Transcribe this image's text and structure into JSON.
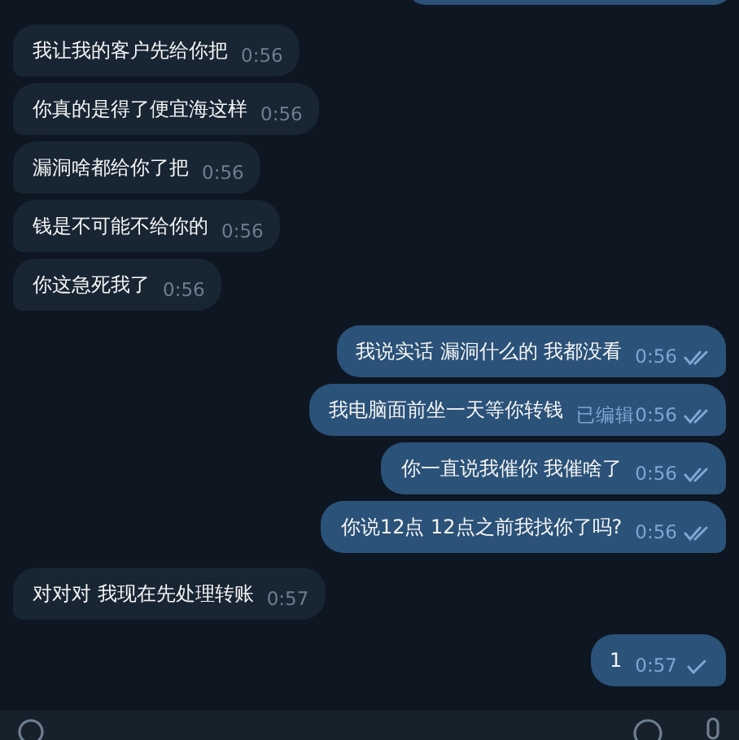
{
  "messages": [
    {
      "kind": "incoming",
      "text": "我让我的客户先给你把",
      "time": "0:56"
    },
    {
      "kind": "incoming",
      "text": "你真的是得了便宜海这样",
      "time": "0:56"
    },
    {
      "kind": "incoming",
      "text": "漏洞啥都给你了把",
      "time": "0:56"
    },
    {
      "kind": "incoming",
      "text": "钱是不可能不给你的",
      "time": "0:56"
    },
    {
      "kind": "incoming",
      "text": "你这急死我了",
      "time": "0:56"
    },
    {
      "kind": "outgoing",
      "text": "我说实话 漏洞什么的 我都没看",
      "time": "0:56",
      "read": true
    },
    {
      "kind": "outgoing",
      "text": "我电脑面前坐一天等你转钱",
      "edited": "已编辑",
      "time": "0:56",
      "read": true
    },
    {
      "kind": "outgoing",
      "text": "你一直说我催你 我催啥了",
      "time": "0:56",
      "read": true
    },
    {
      "kind": "outgoing",
      "text": "你说12点 12点之前我找你了吗?",
      "time": "0:56",
      "read": true
    },
    {
      "kind": "incoming",
      "text": "对对对 我现在先处理转账",
      "time": "0:57"
    },
    {
      "kind": "outgoing",
      "text": "1",
      "time": "0:57",
      "read": false
    }
  ]
}
